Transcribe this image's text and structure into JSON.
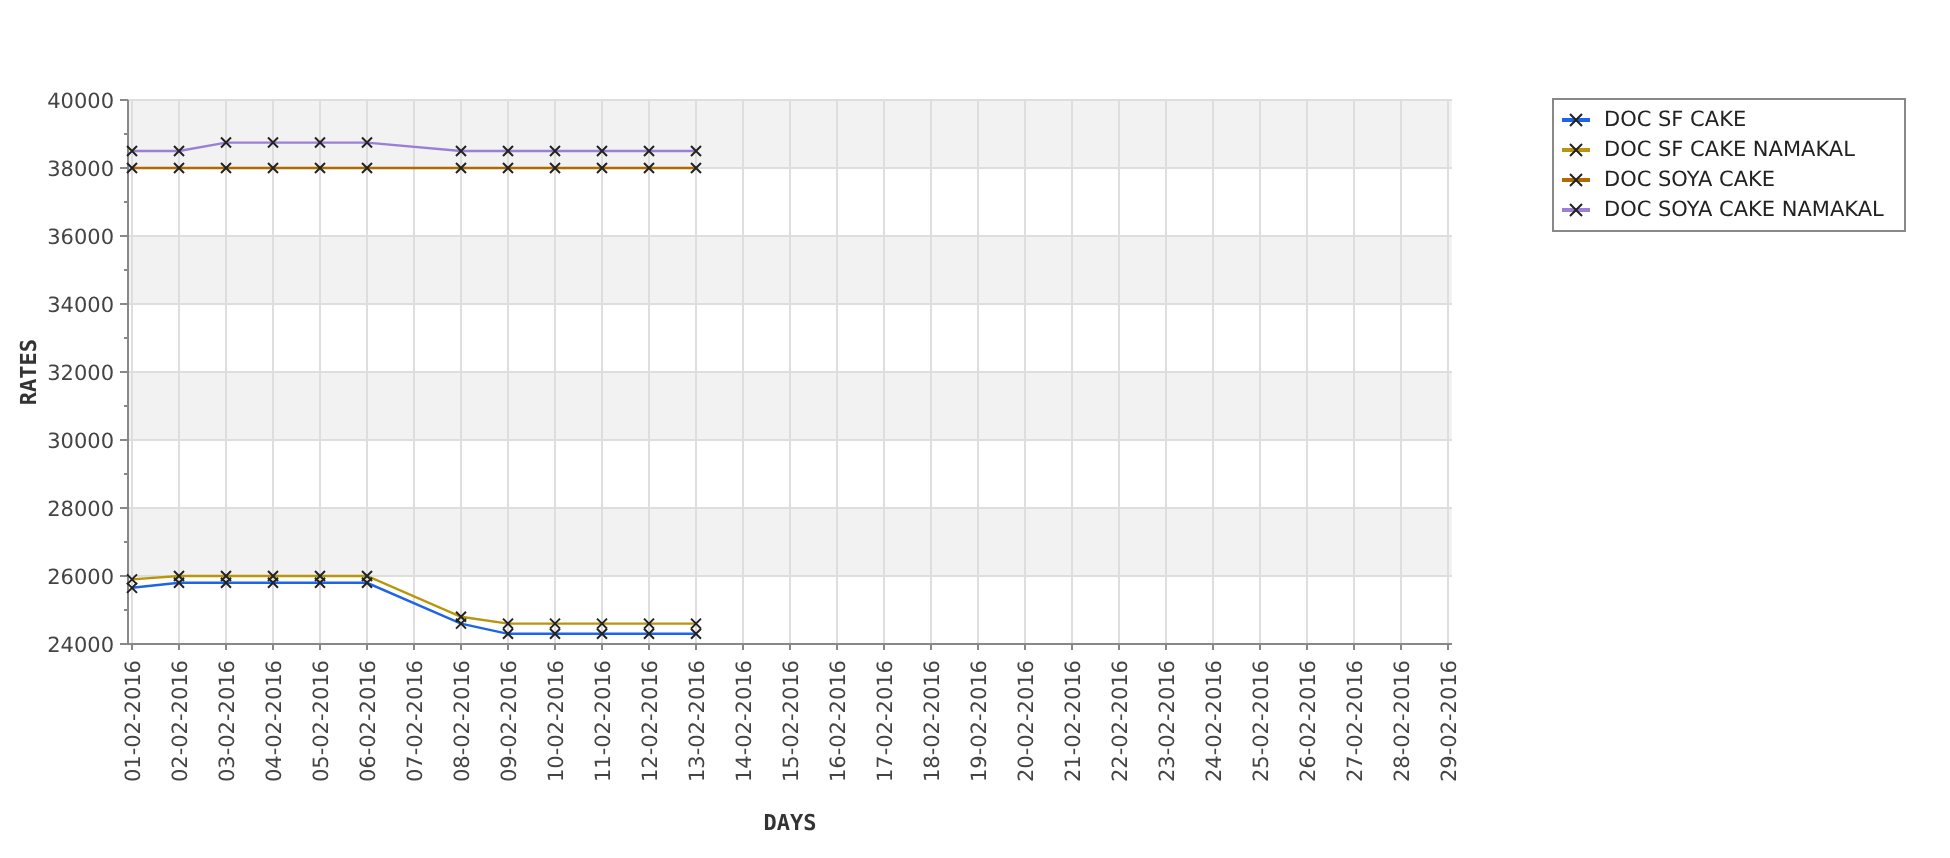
{
  "chart": {
    "chart_data": {
      "type": "line",
      "xlabel": "DAYS",
      "ylabel": "RATES",
      "categories": [
        "01-02-2016",
        "02-02-2016",
        "03-02-2016",
        "04-02-2016",
        "05-02-2016",
        "06-02-2016",
        "07-02-2016",
        "08-02-2016",
        "09-02-2016",
        "10-02-2016",
        "11-02-2016",
        "12-02-2016",
        "13-02-2016",
        "14-02-2016",
        "15-02-2016",
        "16-02-2016",
        "17-02-2016",
        "18-02-2016",
        "19-02-2016",
        "20-02-2016",
        "21-02-2016",
        "22-02-2016",
        "23-02-2016",
        "24-02-2016",
        "25-02-2016",
        "26-02-2016",
        "27-02-2016",
        "28-02-2016",
        "29-02-2016"
      ],
      "grid": true,
      "ylim": [
        24000,
        40000
      ],
      "yticks": [
        24000,
        26000,
        28000,
        30000,
        32000,
        34000,
        36000,
        38000,
        40000
      ],
      "series": [
        {
          "name": "DOC SF CAKE",
          "color": "#1c64e8",
          "marker": "x",
          "values": [
            25650,
            25800,
            25800,
            25800,
            25800,
            25800,
            null,
            24600,
            24300,
            24300,
            24300,
            24300,
            24300,
            null,
            null,
            null,
            null,
            null,
            null,
            null,
            null,
            null,
            null,
            null,
            null,
            null,
            null,
            null,
            null
          ]
        },
        {
          "name": "DOC SF CAKE NAMAKAL",
          "color": "#b8960c",
          "marker": "x",
          "values": [
            25900,
            26000,
            26000,
            26000,
            26000,
            26000,
            null,
            24800,
            24600,
            24600,
            24600,
            24600,
            24600,
            null,
            null,
            null,
            null,
            null,
            null,
            null,
            null,
            null,
            null,
            null,
            null,
            null,
            null,
            null,
            null
          ]
        },
        {
          "name": "DOC SOYA CAKE",
          "color": "#b06a00",
          "marker": "x",
          "values": [
            38000,
            38000,
            38000,
            38000,
            38000,
            38000,
            null,
            38000,
            38000,
            38000,
            38000,
            38000,
            38000,
            null,
            null,
            null,
            null,
            null,
            null,
            null,
            null,
            null,
            null,
            null,
            null,
            null,
            null,
            null,
            null
          ]
        },
        {
          "name": "DOC SOYA CAKE NAMAKAL",
          "color": "#9b7fd4",
          "marker": "x",
          "values": [
            38500,
            38500,
            38750,
            38750,
            38750,
            38750,
            null,
            38500,
            38500,
            38500,
            38500,
            38500,
            38500,
            null,
            null,
            null,
            null,
            null,
            null,
            null,
            null,
            null,
            null,
            null,
            null,
            null,
            null,
            null,
            null
          ]
        }
      ]
    }
  }
}
